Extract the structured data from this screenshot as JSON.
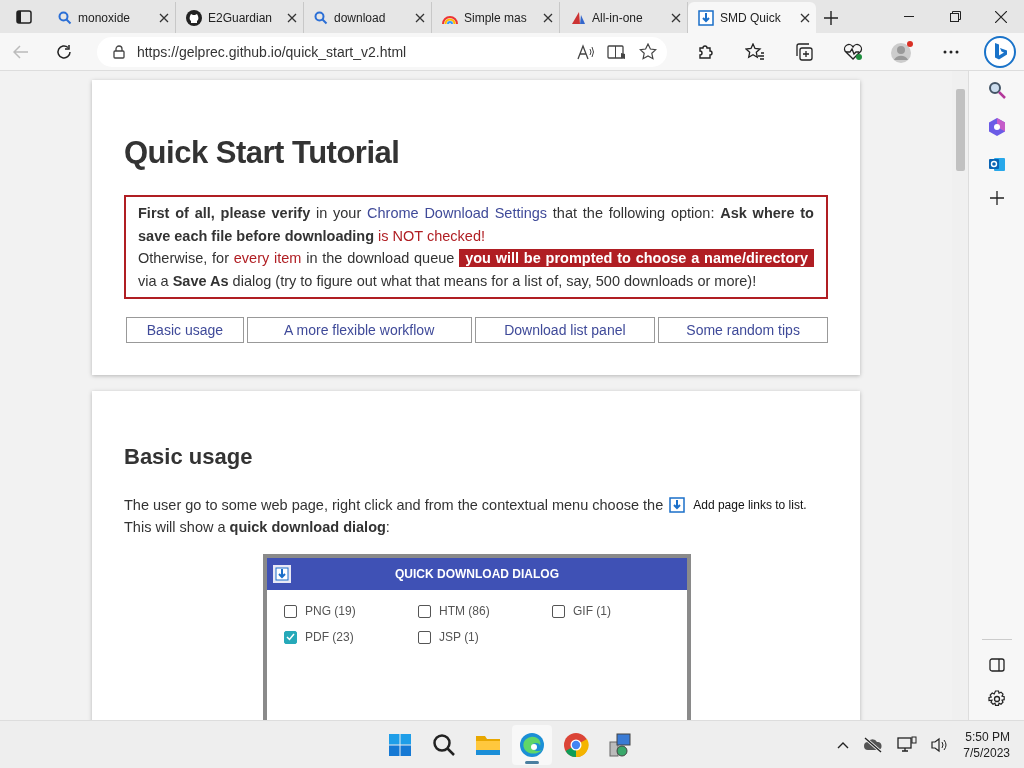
{
  "tabs": [
    {
      "title": "monoxide",
      "selected": false
    },
    {
      "title": "E2Guardian",
      "selected": false
    },
    {
      "title": "download",
      "selected": false
    },
    {
      "title": "Simple mas",
      "selected": false
    },
    {
      "title": "All-in-one",
      "selected": false
    },
    {
      "title": "SMD Quick",
      "selected": true
    }
  ],
  "address_bar": {
    "url": "https://gelprec.github.io/quick_start_v2.html"
  },
  "page": {
    "title": "Quick Start Tutorial",
    "warning": [
      {
        "kind": "bold",
        "text": "First of all, please verify"
      },
      {
        "kind": "plain",
        "text": " in your "
      },
      {
        "kind": "link",
        "text": "Chrome Download Settings"
      },
      {
        "kind": "plain",
        "text": " that the following option: "
      },
      {
        "kind": "bold",
        "text": "Ask where to save each file before downloading"
      },
      {
        "kind": "alert",
        "text": " is NOT checked!"
      },
      {
        "kind": "break"
      },
      {
        "kind": "plain",
        "text": "Otherwise, for "
      },
      {
        "kind": "alert",
        "text": "every item"
      },
      {
        "kind": "plain",
        "text": " in the download queue "
      },
      {
        "kind": "highlight",
        "text": "you will be prompted to choose a name/directory"
      },
      {
        "kind": "plain",
        "text": " via a "
      },
      {
        "kind": "bold",
        "text": "Save As"
      },
      {
        "kind": "plain",
        "text": " dialog (try to figure out what that means for a list of, say, 500 downloads or more)!"
      }
    ],
    "nav_buttons": [
      "Basic usage",
      "A more flexible workflow",
      "Download list panel",
      "Some random tips"
    ],
    "section": {
      "heading": "Basic usage",
      "intro": "The user go to some web page, right click and from the contextual menu choose the",
      "menu_item": "Add page links to list.",
      "result": "This will show a **quick download dialog**:",
      "dialog": {
        "title": "QUICK DOWNLOAD DIALOG",
        "options": [
          {
            "label": "PNG (19)",
            "checked": false
          },
          {
            "label": "HTM (86)",
            "checked": false
          },
          {
            "label": "GIF (1)",
            "checked": false
          },
          {
            "label": "PDF (23)",
            "checked": true
          },
          {
            "label": "JSP (1)",
            "checked": false
          }
        ]
      }
    }
  },
  "taskbar": {
    "apps": [
      {
        "active": false
      },
      {
        "active": false
      },
      {
        "active": false
      },
      {
        "active": true
      },
      {
        "active": false
      },
      {
        "active": false
      }
    ],
    "time": "5:50 PM",
    "date": "7/5/2023"
  }
}
